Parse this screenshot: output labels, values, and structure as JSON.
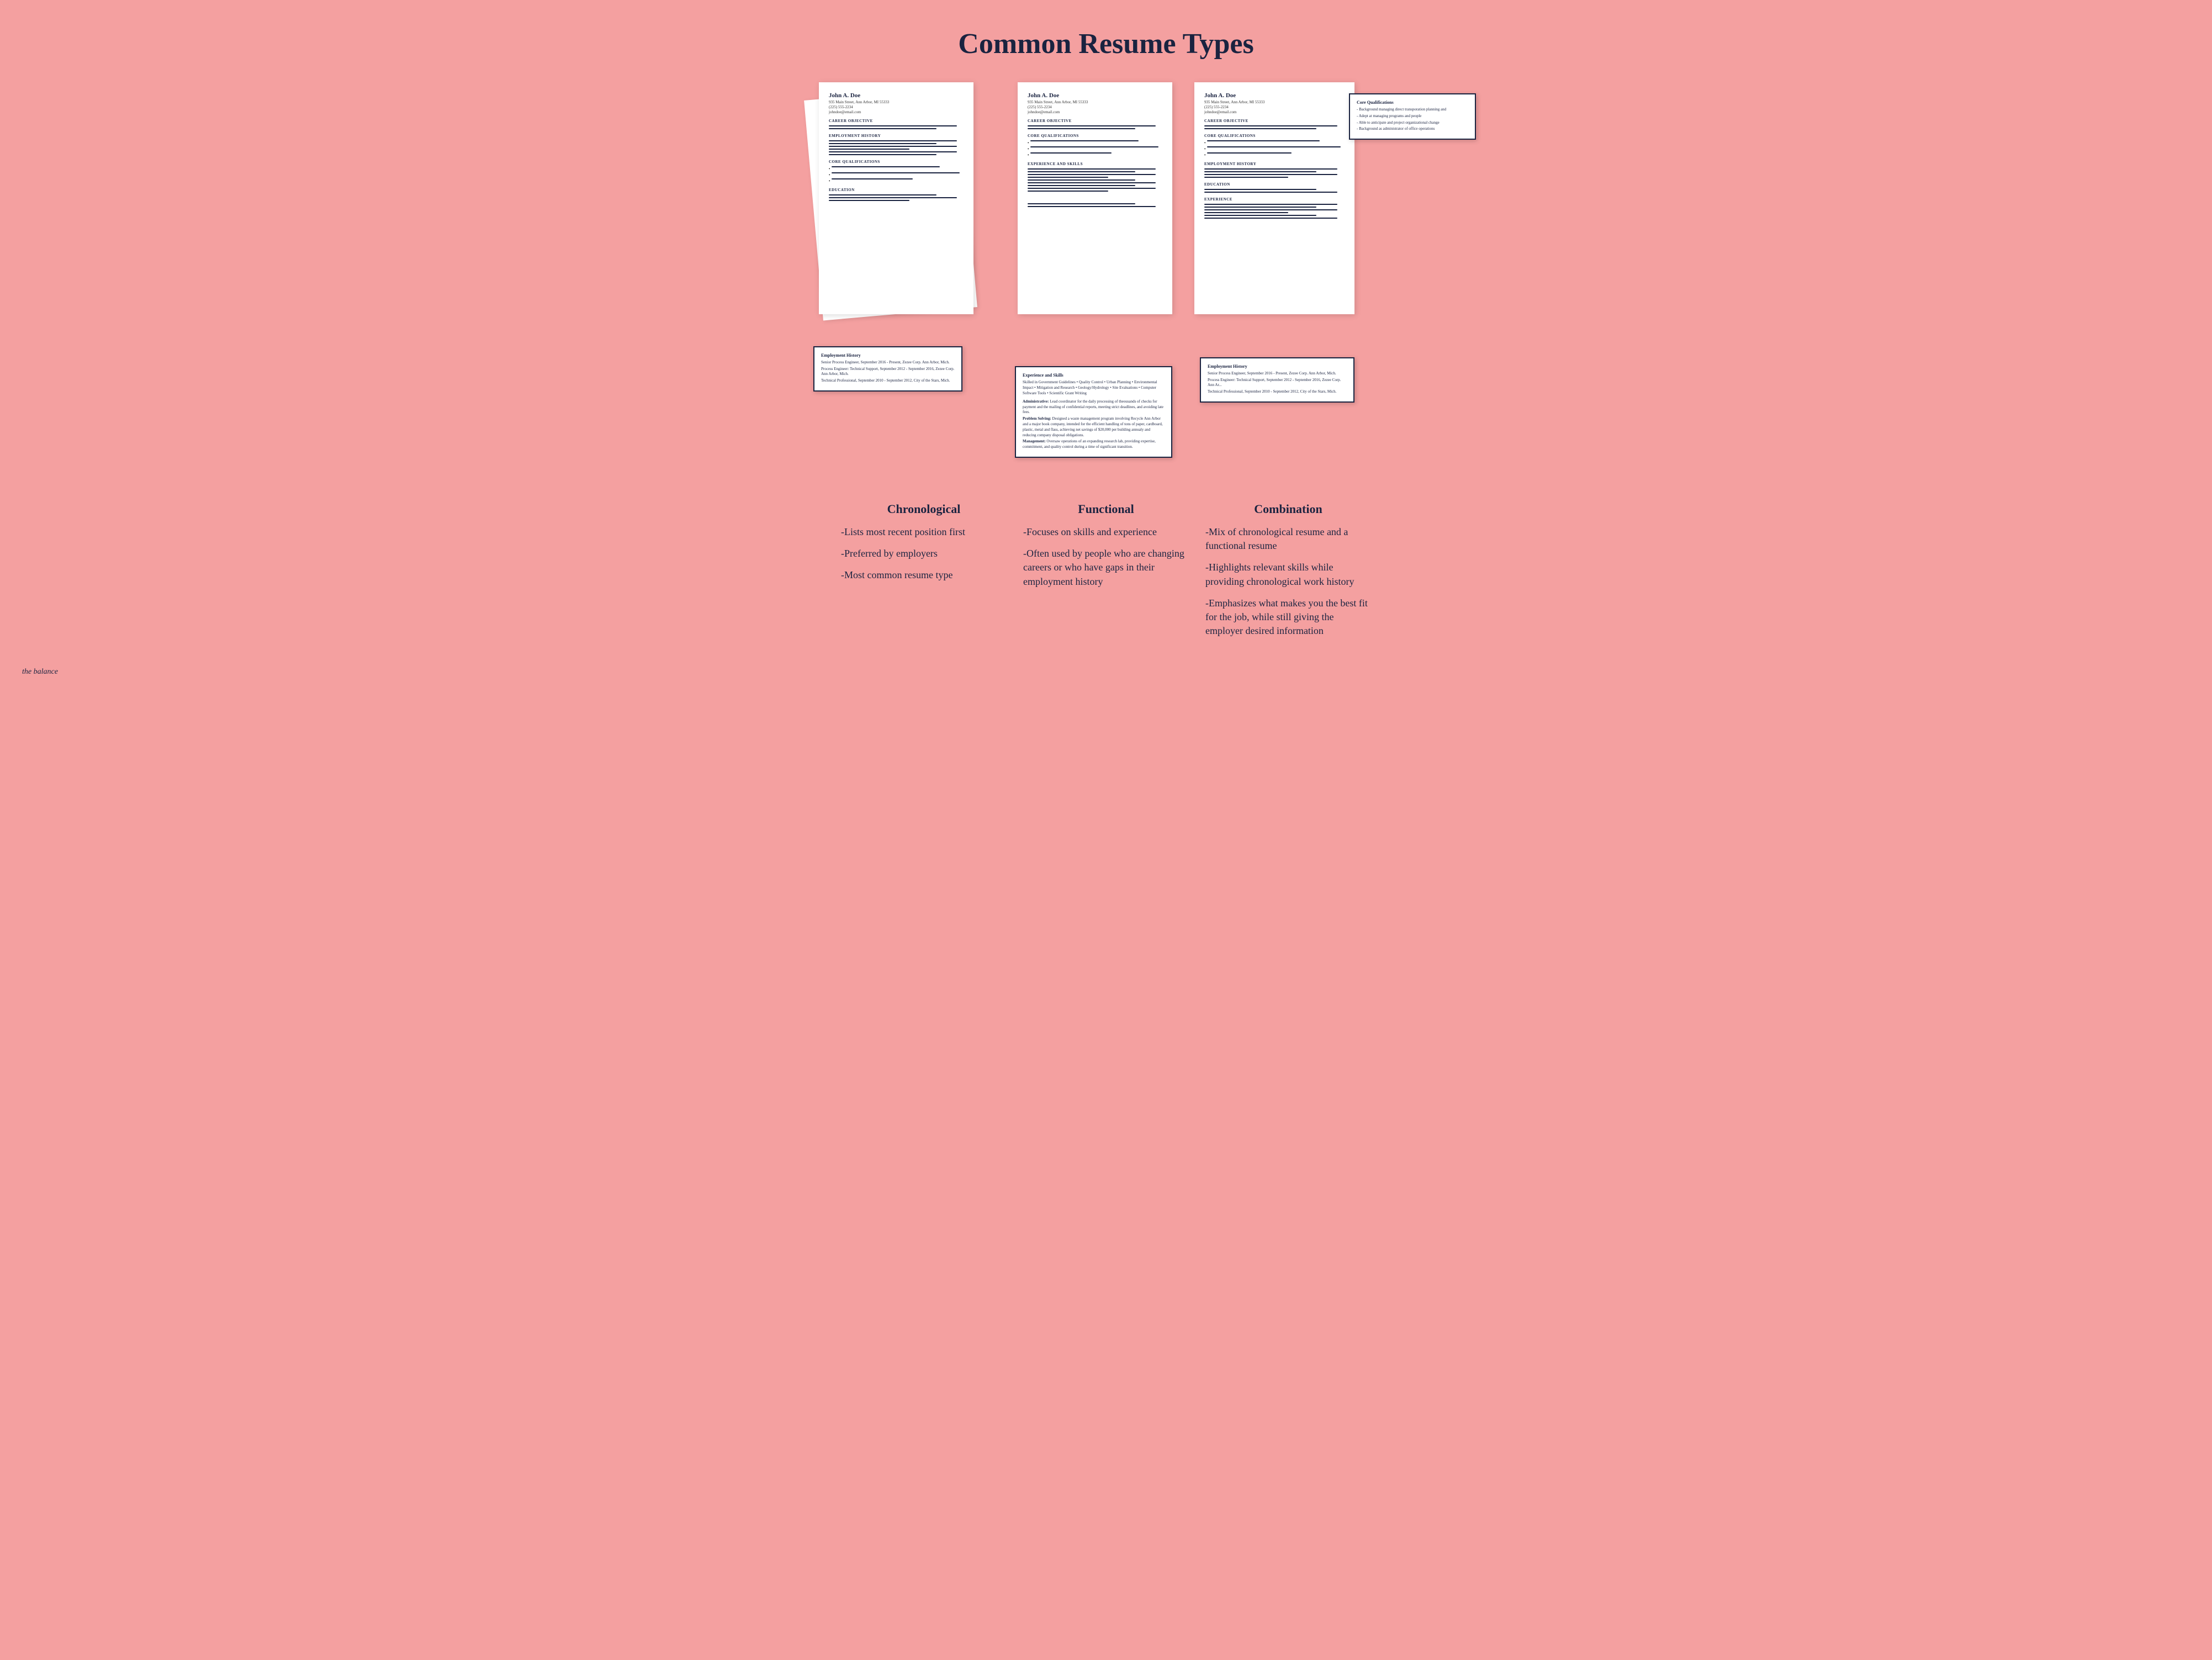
{
  "page": {
    "title": "Common Resume Types",
    "background_color": "#f4a0a0",
    "brand": "the balance"
  },
  "resumes": [
    {
      "id": "chronological",
      "name": "John A. Doe",
      "address": "935 Main Street, Ann Arbor, MI 55333",
      "phone": "(225) 555-2234",
      "email": "johndoe@email.com",
      "sections": [
        {
          "title": "CAREER OBJECTIVE"
        },
        {
          "title": "EMPLOYMENT HISTORY"
        },
        {
          "title": "CORE QUALIFICATIONS"
        },
        {
          "title": "EDUCATION"
        }
      ],
      "callout": {
        "title": "Employment History",
        "lines": [
          "Senior Process Engineer, September 2016 - Present, Zezee Corp. Ann Arbor, Mich.",
          "Process Engineer: Technical Support, September 2012 - September 2016, Zezee Corp. Ann Arbor, Mich.",
          "Technical Professional, September 2010 - September 2012, City of the Stars, Mich."
        ]
      }
    },
    {
      "id": "functional",
      "name": "John A. Doe",
      "address": "935 Main Street, Ann Arbor, MI 55333",
      "phone": "(225) 555-2234",
      "email": "johndoe@email.com",
      "sections": [
        {
          "title": "CAREER OBJECTIVE"
        },
        {
          "title": "CORE QUALIFICATIONS"
        },
        {
          "title": "EXPERIENCE AND SKILLS"
        }
      ],
      "callout": {
        "title": "Experience and Skills",
        "intro": "Skilled in Government Guidelines • Quality Control • Urban Planning • Environmental Impact • Mitigation and Research • Geology/Hydrology • Site Evaluations • Computer Software Tools • Scientific Grant Writing",
        "items": [
          {
            "label": "Administrative:",
            "text": "Lead coordinator for the daily processing of theousands of checks for payment and the mailing of confidential reports, meeting strict deadlines, and avoiding late fees."
          },
          {
            "label": "Problem Solving:",
            "text": "Designed a waste management program involving Recycle Ann Arbor and a major book company, intended for the efficient handling of tons of paper, cardboard, plastic, metal and flass, achieving net savings of $20,000 per building annualy and reducing company disposal obligations."
          },
          {
            "label": "Management:",
            "text": "Oversaw operations of an expanding research lab, providing expertise, commitment, and quality control during a time of significant transition."
          }
        ]
      }
    },
    {
      "id": "combination",
      "name": "John A. Doe",
      "address": "935 Main Street, Ann Arbor, MI 55333",
      "phone": "(225) 555-2234",
      "email": "johndoe@email.com",
      "sections": [
        {
          "title": "CAREER OBJECTIVE"
        },
        {
          "title": "CORE QUALIFICATIONS"
        },
        {
          "title": "EMPLOYMENT HISTORY"
        },
        {
          "title": "EDUCATION"
        },
        {
          "title": "EXPERIENCE"
        }
      ],
      "callout_top": {
        "title": "Core Qualifications",
        "lines": [
          "- Background managing direct transporation planning and",
          "- Adept at managing programs and people",
          "- Able to anticipate and project organizational change",
          "- Background as administrator of office operations"
        ]
      },
      "callout_bottom": {
        "title": "Employment History",
        "lines": [
          "Senior Process Engineer, September 2016 - Present, Zezee Corp. Ann Arbor, Mich.",
          "Process Engineer: Technical Support, September 2012 - September 2016, Zezee Corp. Ann Ar...",
          "Technical Professional, September 2010 - September 2012, City of the Stars, Mich."
        ]
      }
    }
  ],
  "descriptions": [
    {
      "id": "chronological",
      "title": "Chronological",
      "items": [
        "-Lists most recent position first",
        "-Preferred by employers",
        "-Most common resume type"
      ]
    },
    {
      "id": "functional",
      "title": "Functional",
      "items": [
        "-Focuses on skills and experience",
        "-Often used by people who are changing careers or who have gaps in their employment history"
      ]
    },
    {
      "id": "combination",
      "title": "Combination",
      "items": [
        "-Mix of chronological resume and a functional resume",
        "-Highlights relevant skills while providing chronological work history",
        "-Emphasizes what makes you the best fit for the job, while still giving the employer desired information"
      ]
    }
  ]
}
